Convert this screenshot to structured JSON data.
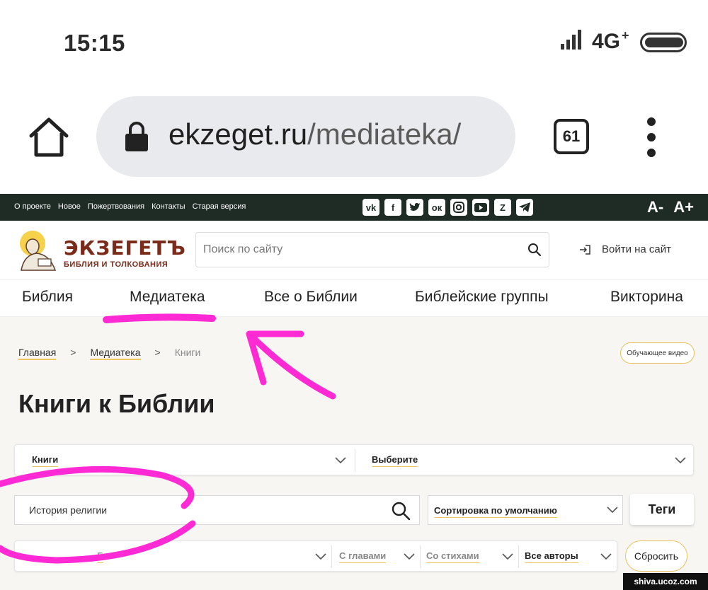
{
  "status": {
    "time": "15:15",
    "network": "4G"
  },
  "browser": {
    "url_host": "ekzeget.ru",
    "url_path": "/mediateka/",
    "tab_count": "61"
  },
  "topbar": {
    "links": [
      "О проекте",
      "Новое",
      "Пожертвования",
      "Контакты",
      "Старая версия"
    ],
    "social_icons": [
      "vk-icon",
      "facebook-icon",
      "twitter-icon",
      "odnoklassniki-icon",
      "instagram-icon",
      "youtube-icon",
      "zen-icon",
      "telegram-icon"
    ],
    "font_minus": "A-",
    "font_plus": "A+"
  },
  "header": {
    "logo_title": "ЭКЗЕГЕТЪ",
    "logo_subtitle": "БИБЛИЯ И ТОЛКОВАНИЯ",
    "search_placeholder": "Поиск по сайту",
    "login_label": "Войти на сайт"
  },
  "nav": {
    "items": [
      "Библия",
      "Медиатека",
      "Все о Библии",
      "Библейские группы",
      "Викторина"
    ]
  },
  "breadcrumb": {
    "home": "Главная",
    "section": "Медиатека",
    "current": "Книги",
    "separator": ">"
  },
  "video_button": "Обучающее видео",
  "page_title": "Книги к Библии",
  "filters": {
    "type_select": "Книги",
    "category_select": "Выберите",
    "query_value": "История религии",
    "sort_select": "Сортировка по умолчанию",
    "tags_button": "Теги",
    "book_select": "Б",
    "chapters_select": "С главами",
    "verses_select": "Со стихами",
    "authors_select": "Все авторы",
    "reset_button": "Сбросить"
  },
  "watermark": "shiva.ucoz.com",
  "colors": {
    "topbar_bg": "#1f2b25",
    "accent_gold": "#f0c75e",
    "logo_brown": "#7a2b1a",
    "annotation_magenta": "#ff2ad4"
  }
}
